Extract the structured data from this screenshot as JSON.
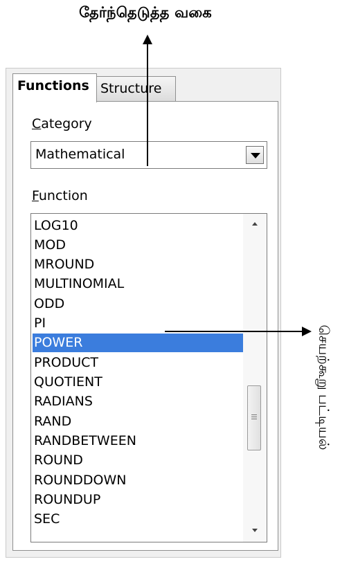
{
  "annotations": {
    "selected_category": "தேர்ந்தெடுத்த வகை",
    "function_list": "செயற்கூறு பட்டியல்"
  },
  "tabs": [
    {
      "label": "Functions",
      "active": true
    },
    {
      "label": "Structure",
      "active": false
    }
  ],
  "category": {
    "label_first": "C",
    "label_rest": "ategory",
    "value": "Mathematical"
  },
  "function": {
    "label_first": "F",
    "label_rest": "unction",
    "items": [
      "LOG10",
      "MOD",
      "MROUND",
      "MULTINOMIAL",
      "ODD",
      "PI",
      "POWER",
      "PRODUCT",
      "QUOTIENT",
      "RADIANS",
      "RAND",
      "RANDBETWEEN",
      "ROUND",
      "ROUNDDOWN",
      "ROUNDUP",
      "SEC"
    ],
    "selected": "POWER"
  },
  "colors": {
    "selection": "#3b7ddd",
    "panel": "#f0f0f0"
  }
}
